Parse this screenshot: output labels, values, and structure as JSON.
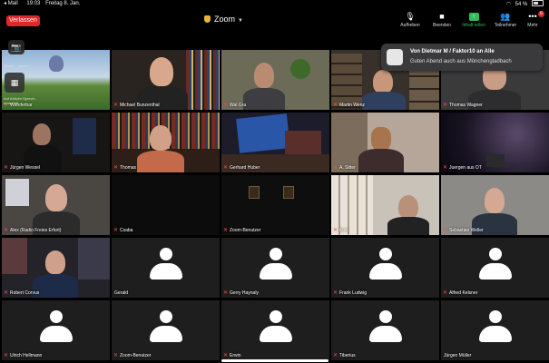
{
  "status_bar": {
    "carrier": "Mail",
    "time": "19:03",
    "date": "Freitag 8. Jan.",
    "battery": "54 %",
    "battery_level": 0.54
  },
  "top_bar": {
    "leave_label": "Verlassen",
    "title": "Zoom",
    "buttons": [
      {
        "label": "Aufheben",
        "icon": "mic-off-icon"
      },
      {
        "label": "Beenden",
        "icon": "video-camera-icon"
      },
      {
        "label": "Inhalt teilen",
        "icon": "share-screen-icon"
      },
      {
        "label": "Teilnehmer",
        "icon": "participants-icon"
      },
      {
        "label": "Mehr",
        "icon": "more-icon",
        "badge": "6"
      }
    ]
  },
  "notification": {
    "title": "Von Dietmar M / Faktor10 an Alle",
    "body": "Guten Abend auch aus Mönchengladbach"
  },
  "self_view": {
    "label_top": "Kamer... wechs...",
    "label_bottom": "Auf Aktiven Sprech... umschalt..."
  },
  "participants": [
    {
      "name": "Wunderbar",
      "muted": true,
      "video": "scene-game"
    },
    {
      "name": "Michael Bunzenthal",
      "muted": true,
      "video": "scene-books"
    },
    {
      "name": "Wal Gra",
      "muted": true,
      "video": "scene-plant"
    },
    {
      "name": "Martin Wenz",
      "muted": true,
      "video": "scene-headset-shelf"
    },
    {
      "name": "Thomas Wagner",
      "muted": true,
      "video": "scene-glasses"
    },
    {
      "name": "Jürgen Wessel",
      "muted": true,
      "video": "scene-dark-poster"
    },
    {
      "name": "Thomas",
      "muted": true,
      "video": "scene-books-red"
    },
    {
      "name": "Gerhard Huber",
      "muted": true,
      "video": "scene-perry-banner"
    },
    {
      "name": "A. Sitter",
      "muted": true,
      "video": "scene-woman"
    },
    {
      "name": "Juergen aus OT",
      "muted": true,
      "video": "scene-space"
    },
    {
      "name": "Alex (Radio Freies Erfurt)",
      "muted": true,
      "video": "scene-radio"
    },
    {
      "name": "Csaba",
      "muted": true,
      "video": "scene-dark"
    },
    {
      "name": "Zoom-Benutzer",
      "muted": true,
      "video": "scene-frames"
    },
    {
      "name": "Kurt",
      "muted": true,
      "video": "scene-beard"
    },
    {
      "name": "Sebastian Weller",
      "muted": true,
      "video": "scene-young"
    },
    {
      "name": "Robert Corvus",
      "muted": true,
      "video": "scene-headset"
    },
    {
      "name": "Gerald",
      "muted": false,
      "video": "avatar"
    },
    {
      "name": "Gerry Haynaly",
      "muted": true,
      "video": "avatar"
    },
    {
      "name": "Frank Ludwig",
      "muted": true,
      "video": "avatar"
    },
    {
      "name": "Alfred Kelsner",
      "muted": true,
      "video": "avatar"
    },
    {
      "name": "Ulrich Hellmann",
      "muted": true,
      "video": "avatar"
    },
    {
      "name": "Zoom-Benutzer",
      "muted": true,
      "video": "avatar"
    },
    {
      "name": "Erwin",
      "muted": true,
      "video": "avatar"
    },
    {
      "name": "Tiberius",
      "muted": true,
      "video": "avatar"
    },
    {
      "name": "Jürgen Müller",
      "muted": false,
      "video": "avatar"
    }
  ]
}
